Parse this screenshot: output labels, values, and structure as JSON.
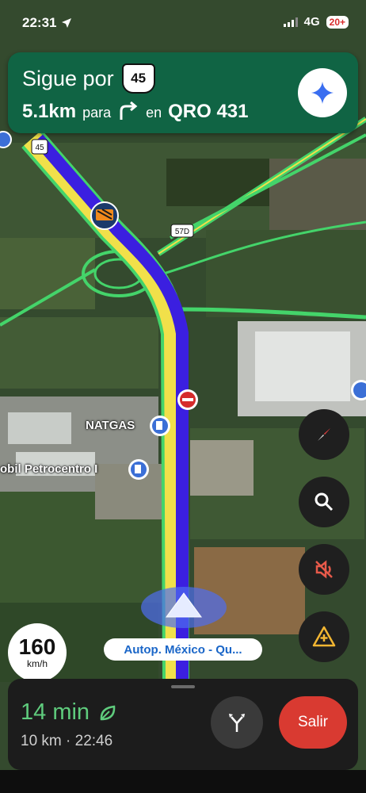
{
  "status_bar": {
    "time": "22:31",
    "network": "4G",
    "battery": "20+"
  },
  "banner": {
    "instruction": "Sigue por",
    "highway_number": "45",
    "distance": "5.1km",
    "distance_suffix": "para",
    "preposition": "en",
    "target_road": "QRO 431",
    "background_color": "#106444"
  },
  "map": {
    "highway_shields": [
      "45",
      "57D"
    ],
    "poi_labels": {
      "natgas": "NATGAS",
      "mobil": "obil Petrocentro I"
    },
    "route_color": "#3b1fe0"
  },
  "speed": {
    "value": "160",
    "unit": "km/h"
  },
  "current_street": "Autop. México - Qu...",
  "bottom_panel": {
    "eta_minutes": "14 min",
    "distance_and_arrival": "10 km · 22:46",
    "exit_label": "Salir",
    "eta_color": "#5fcc7d",
    "exit_color": "#d93a31"
  },
  "icons": [
    "location-arrow-icon",
    "signal-icon",
    "sparkle-icon",
    "compass-icon",
    "search-icon",
    "sound-muted-icon",
    "report-incident-icon",
    "leaf-icon",
    "alternate-routes-icon",
    "navigation-arrow-icon",
    "gas-station-icon",
    "construction-icon",
    "no-entry-icon",
    "turn-right-icon"
  ]
}
